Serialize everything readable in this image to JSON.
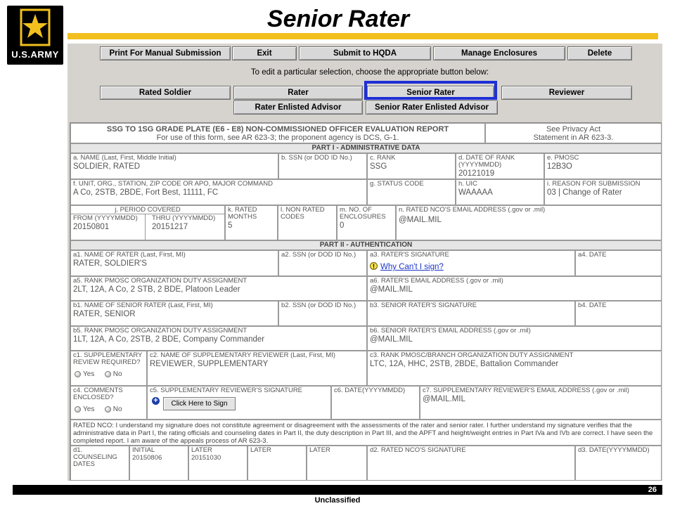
{
  "slide": {
    "title": "Senior Rater",
    "logo_text": "U.S.ARMY",
    "page_number": "26",
    "classification": "Unclassified"
  },
  "colors": {
    "gold": "#f2c01e",
    "selection": "#1e2fd6",
    "frame": "#d6d3ce"
  },
  "toolbar": {
    "print": "Print For Manual Submission",
    "exit": "Exit",
    "submit": "Submit to HQDA",
    "manage": "Manage Enclosures",
    "delete": "Delete"
  },
  "instructions": "To edit a particular selection, choose the appropriate button below:",
  "sections": {
    "rated_soldier": "Rated Soldier",
    "rater": "Rater",
    "senior_rater": "Senior Rater",
    "reviewer": "Reviewer",
    "rater_enlisted_advisor": "Rater Enlisted Advisor",
    "senior_rater_enlisted_advisor": "Senior Rater Enlisted Advisor"
  },
  "form": {
    "title": "SSG TO 1SG GRADE PLATE (E6 - E8) NON-COMMISSIONED OFFICER EVALUATION REPORT",
    "subtitle": "For use of this form, see AR 623-3; the proponent agency is DCS, G-1.",
    "privacy_1": "See Privacy Act",
    "privacy_2": "Statement in AR 623-3.",
    "part1": "PART I - ADMINISTRATIVE DATA",
    "name_label": "a. NAME (Last, First, Middle Initial)",
    "name_value": "SOLDIER, RATED",
    "ssn_label": "b. SSN (or DOD ID No.)",
    "rank_label": "c. RANK",
    "rank_value": "SSG",
    "dor_label": "d. DATE OF RANK (YYYYMMDD)",
    "dor_value": "20121019",
    "pmosc_label": "e. PMOSC",
    "pmosc_value": "12B3O",
    "unit_label": "f. UNIT, ORG., STATION, ZIP CODE OR APO, MAJOR COMMAND",
    "unit_value": "A Co, 2STB, 2BDE, Fort Best, 11111, FC",
    "status_label": "g. STATUS CODE",
    "uic_label": "h. UIC",
    "uic_value": "WAAAAA",
    "reason_label": "i. REASON FOR SUBMISSION",
    "reason_value": "03 | Change of Rater",
    "period_label": "j. PERIOD COVERED",
    "from_label": "FROM (YYYYMMDD)",
    "from_value": "20150801",
    "thru_label": "THRU (YYYYMMDD)",
    "thru_value": "20151217",
    "months_label": "k. RATED MONTHS",
    "months_value": "5",
    "nonrated_label": "l. NON RATED CODES",
    "encl_label": "m. NO. OF ENCLOSURES",
    "encl_value": "0",
    "nco_email_label": "n. RATED NCO'S EMAIL ADDRESS (.gov or .mil)",
    "nco_email_value": "@MAIL.MIL",
    "part2": "PART II - AUTHENTICATION",
    "a1_label": "a1. NAME OF RATER (Last, First, MI)",
    "a1_value": "RATER, SOLDIER'S",
    "a2_label": "a2. SSN (or DOD ID No.)",
    "a3_label": "a3. RATER'S SIGNATURE",
    "a3_link": "Why Can't I sign?",
    "a4_label": "a4. DATE",
    "a5_label": "a5. RANK PMOSC ORGANIZATION DUTY ASSIGNMENT",
    "a5_value": "2LT, 12A, A Co, 2 STB, 2 BDE, Platoon Leader",
    "a6_label": "a6. RATER'S EMAIL ADDRESS (.gov or .mil)",
    "a6_value": "@MAIL.MIL",
    "b1_label": "b1. NAME OF SENIOR RATER (Last, First, MI)",
    "b1_value": "RATER, SENIOR",
    "b2_label": "b2. SSN (or DOD ID No.)",
    "b3_label": "b3. SENIOR RATER'S SIGNATURE",
    "b4_label": "b4. DATE",
    "b5_label": "b5. RANK PMOSC ORGANIZATION DUTY ASSIGNMENT",
    "b5_value": "1LT, 12A, A Co, 2STB, 2 BDE, Company Commander",
    "b6_label": "b6. SENIOR RATER'S EMAIL ADDRESS (.gov or .mil)",
    "b6_value": "@MAIL.MIL",
    "c1_label": "c1. SUPPLEMENTARY REVIEW REQUIRED?",
    "c2_label": "c2. NAME OF SUPPLEMENTARY REVIEWER (Last, First, MI)",
    "c2_value": "REVIEWER, SUPPLEMENTARY",
    "c3_label": "c3. RANK PMOSC/BRANCH ORGANIZATION DUTY ASSIGNMENT",
    "c3_value": "LTC, 12A, HHC, 2STB, 2BDE, Battalion Commander",
    "c4_label": "c4. COMMENTS ENCLOSED?",
    "c5_label": "c5. SUPPLEMENTARY REVIEWER'S SIGNATURE",
    "c5_button": "Click Here to Sign",
    "c6_label": "c6. DATE(YYYYMMDD)",
    "c7_label": "c7. SUPPLEMENTARY REVIEWER'S EMAIL ADDRESS (.gov or .mil)",
    "c7_value": "@MAIL.MIL",
    "yes": "Yes",
    "no": "No",
    "nco_statement": "RATED NCO: I understand my signature does not constitute agreement or disagreement with the assessments of the rater and senior rater. I further understand my signature verifies that the administrative data in Part I, the rating officials and counseling dates in Part II, the duty description in Part III, and the APFT and height/weight entries in Part IVa and IVb are correct. I have seen the completed report. I am aware of the appeals process of AR 623-3.",
    "d1_label": "d1. COUNSELING DATES",
    "initial_label": "INITIAL",
    "initial_value": "20150806",
    "later_label": "LATER",
    "later_value": "20151030",
    "d2_label": "d2. RATED NCO'S SIGNATURE",
    "d3_label": "d3. DATE(YYYYMMDD)"
  }
}
